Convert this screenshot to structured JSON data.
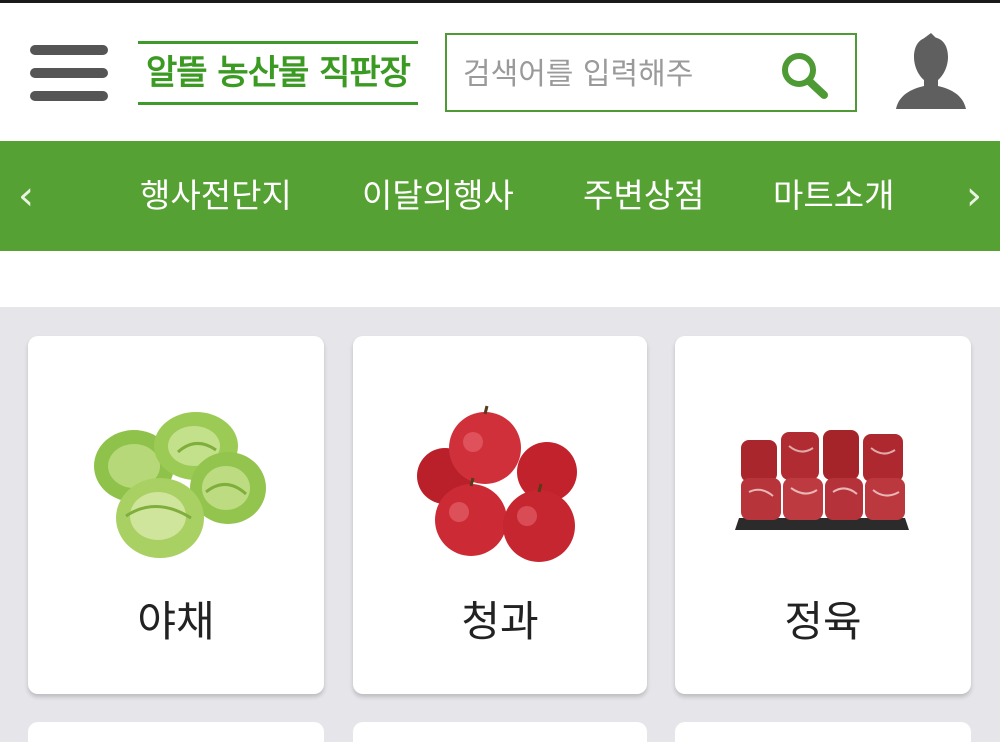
{
  "header": {
    "logo_text": "알뜰 농산물 직판장",
    "search": {
      "placeholder": "검색어를 입력해주",
      "value": ""
    }
  },
  "nav": {
    "items": [
      {
        "label": "행사전단지"
      },
      {
        "label": "이달의행사"
      },
      {
        "label": "주변상점"
      },
      {
        "label": "마트소개"
      }
    ],
    "prev_glyph": "‹",
    "next_glyph": "›"
  },
  "categories": [
    {
      "label": "야채"
    },
    {
      "label": "청과"
    },
    {
      "label": "정육"
    }
  ],
  "colors": {
    "brand_green": "#56a133",
    "logo_green": "#3a9a22",
    "background": "#e6e6ea"
  }
}
